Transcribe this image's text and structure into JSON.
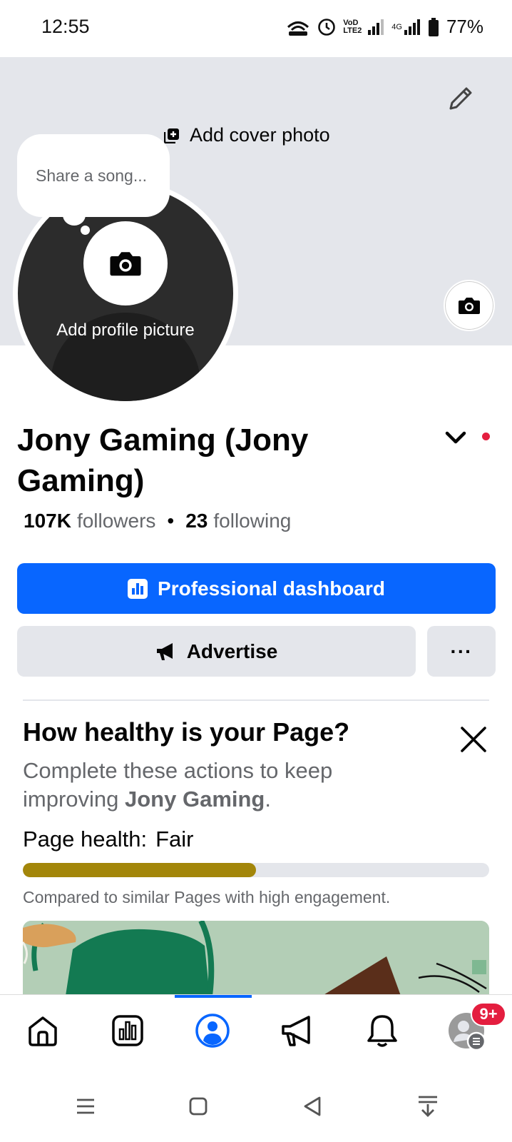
{
  "status_bar": {
    "time": "12:55",
    "battery": "77%",
    "network_label": "4G",
    "volte_label": "VoD LTE2"
  },
  "cover": {
    "add_cover_label": "Add cover photo",
    "edit_icon": "pencil-icon",
    "camera_icon": "camera-icon"
  },
  "profile": {
    "song_prompt": "Share a song...",
    "add_picture_label": "Add profile picture",
    "name": "Jony Gaming (Jony Gaming)",
    "followers_count": "107K",
    "followers_label": "followers",
    "following_count": "23",
    "following_label": "following"
  },
  "actions": {
    "dashboard_label": "Professional dashboard",
    "advertise_label": "Advertise",
    "more_label": "···"
  },
  "health": {
    "title": "How healthy is your Page?",
    "desc_prefix": "Complete these actions to keep improving ",
    "desc_page": "Jony Gaming",
    "desc_suffix": ".",
    "status_label": "Page health:",
    "status_value": "Fair",
    "progress": 0.5,
    "progress_color": "#a3860a",
    "compare_text": "Compared to similar Pages with high engagement."
  },
  "tabs": {
    "items": [
      "home-icon",
      "dashboard-icon",
      "profile-icon",
      "megaphone-icon",
      "bell-icon",
      "account-menu-icon"
    ],
    "active": "profile-icon",
    "badge": "9+"
  },
  "colors": {
    "primary": "#0866ff",
    "badge": "#e41e3f",
    "cover_bg": "#e4e6eb"
  }
}
